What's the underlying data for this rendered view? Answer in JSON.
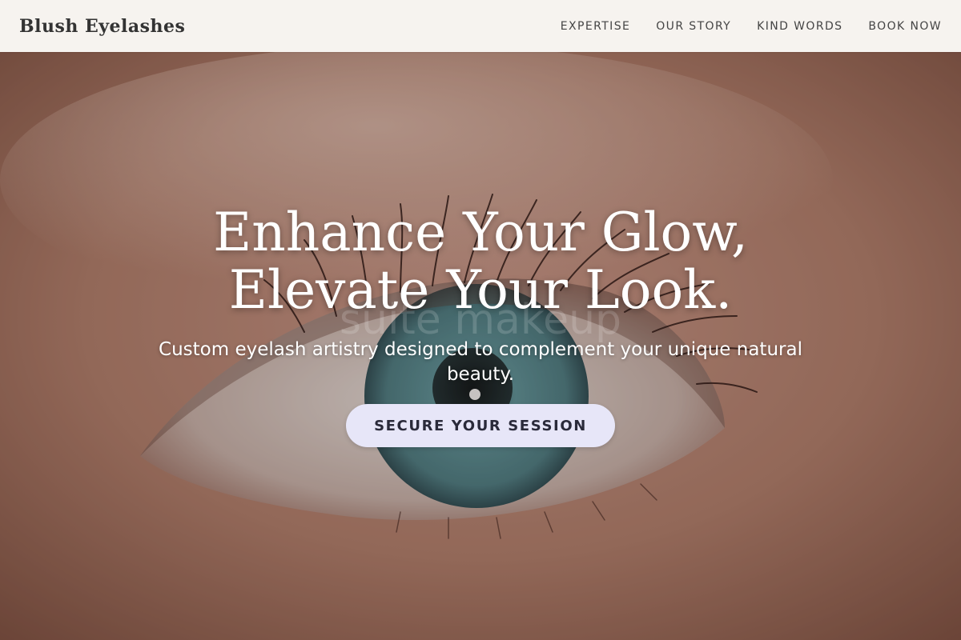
{
  "header": {
    "brand": "Blush Eyelashes",
    "nav": [
      {
        "label": "EXPERTISE"
      },
      {
        "label": "OUR STORY"
      },
      {
        "label": "KIND WORDS"
      },
      {
        "label": "BOOK NOW"
      }
    ]
  },
  "hero": {
    "title_line1": "Enhance Your Glow,",
    "title_line2": "Elevate Your Look.",
    "subtitle": "Custom eyelash artistry designed to complement your unique natural beauty.",
    "cta_label": "SECURE YOUR SESSION",
    "watermark": "suite makeup"
  },
  "colors": {
    "header_bg": "#f6f3ef",
    "cta_bg": "#e7e6f8",
    "iris": "#4f8389"
  }
}
